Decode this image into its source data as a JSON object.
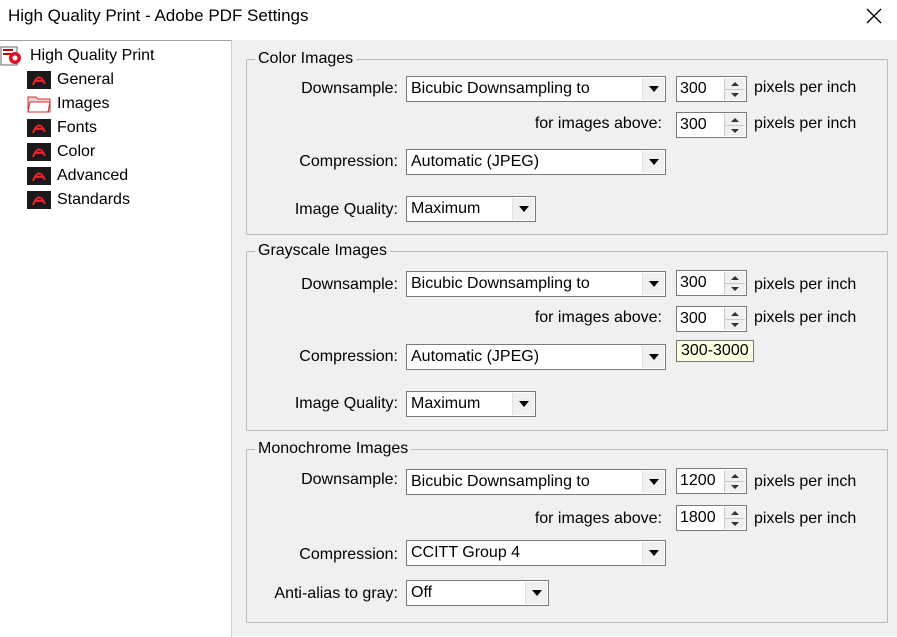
{
  "window": {
    "title": "High Quality Print - Adobe PDF Settings"
  },
  "tree": {
    "root": "High Quality Print",
    "items": [
      {
        "label": "General",
        "icon": "pdf-document-icon"
      },
      {
        "label": "Images",
        "icon": "folder-open-icon"
      },
      {
        "label": "Fonts",
        "icon": "pdf-document-icon"
      },
      {
        "label": "Color",
        "icon": "pdf-document-icon"
      },
      {
        "label": "Advanced",
        "icon": "pdf-document-icon"
      },
      {
        "label": "Standards",
        "icon": "pdf-document-icon"
      }
    ]
  },
  "color": {
    "title": "Color Images",
    "downsample_label": "Downsample:",
    "downsample_value": "Bicubic Downsampling to",
    "ppi": "300",
    "ppi_unit": "pixels per inch",
    "above_label": "for images above:",
    "above_value": "300",
    "above_unit": "pixels per inch",
    "compression_label": "Compression:",
    "compression_value": "Automatic (JPEG)",
    "quality_label": "Image Quality:",
    "quality_value": "Maximum"
  },
  "gray": {
    "title": "Grayscale Images",
    "downsample_label": "Downsample:",
    "downsample_value": "Bicubic Downsampling to",
    "ppi": "300",
    "ppi_unit": "pixels per inch",
    "above_label": "for images above:",
    "above_value": "300",
    "above_unit": "pixels per inch",
    "compression_label": "Compression:",
    "compression_value": "Automatic (JPEG)",
    "quality_label": "Image Quality:",
    "quality_value": "Maximum"
  },
  "tooltip": "300-3000",
  "mono": {
    "title": "Monochrome Images",
    "downsample_label": "Downsample:",
    "downsample_value": "Bicubic Downsampling to",
    "ppi": "1200",
    "ppi_unit": "pixels per inch",
    "above_label": "for images above:",
    "above_value": "1800",
    "above_unit": "pixels per inch",
    "compression_label": "Compression:",
    "compression_value": "CCITT Group 4",
    "antialias_label": "Anti-alias to gray:",
    "antialias_value": "Off"
  }
}
